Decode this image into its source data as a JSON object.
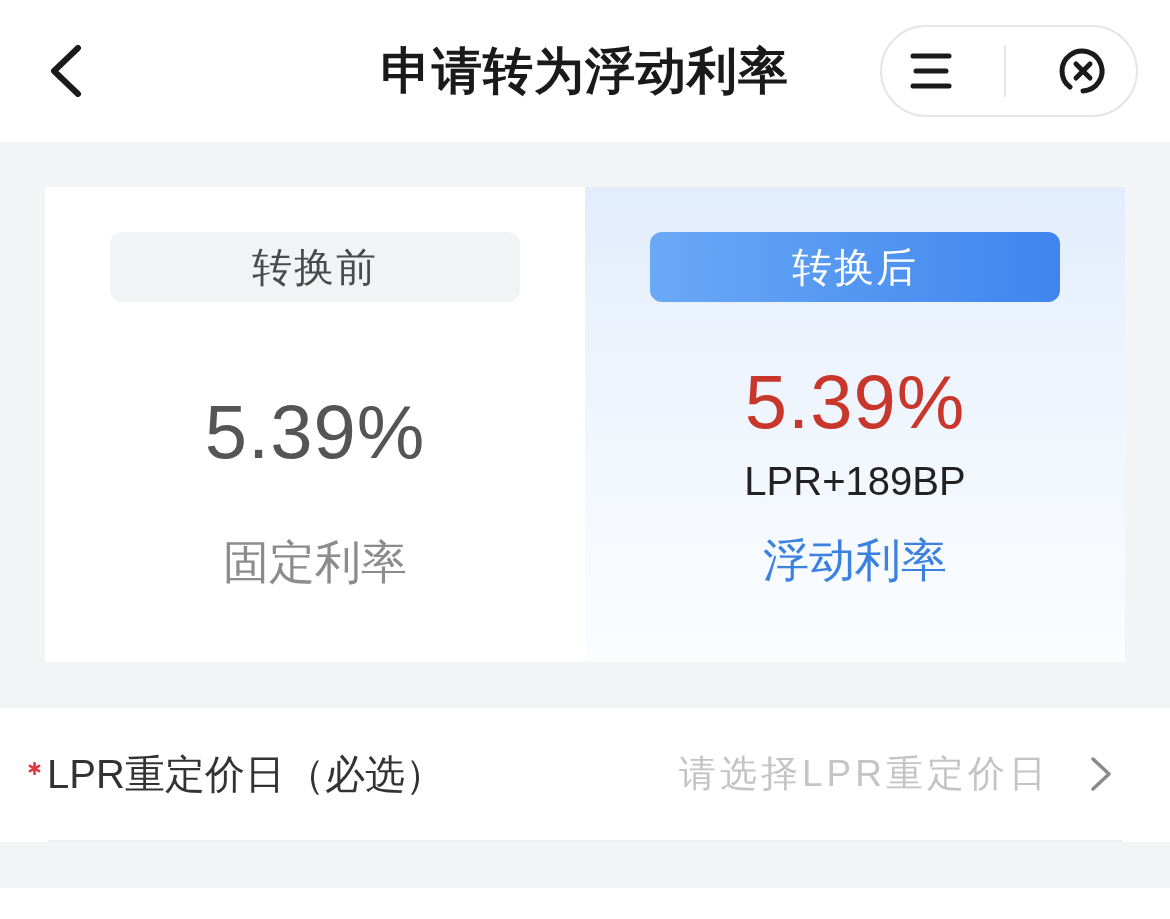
{
  "header": {
    "title": "申请转为浮动利率"
  },
  "comparison": [
    {
      "tab": {
        "label": "转换前",
        "selected": false
      },
      "rate": "5.39%",
      "rate_type": "固定利率"
    },
    {
      "tab": {
        "label": "转换后",
        "selected": true
      },
      "rate": "5.39%",
      "spread": "LPR+189BP",
      "rate_type": "浮动利率"
    }
  ],
  "form": [
    {
      "required": true,
      "label": "LPR重定价日（必选）",
      "placeholder": "请选择LPR重定价日"
    }
  ]
}
